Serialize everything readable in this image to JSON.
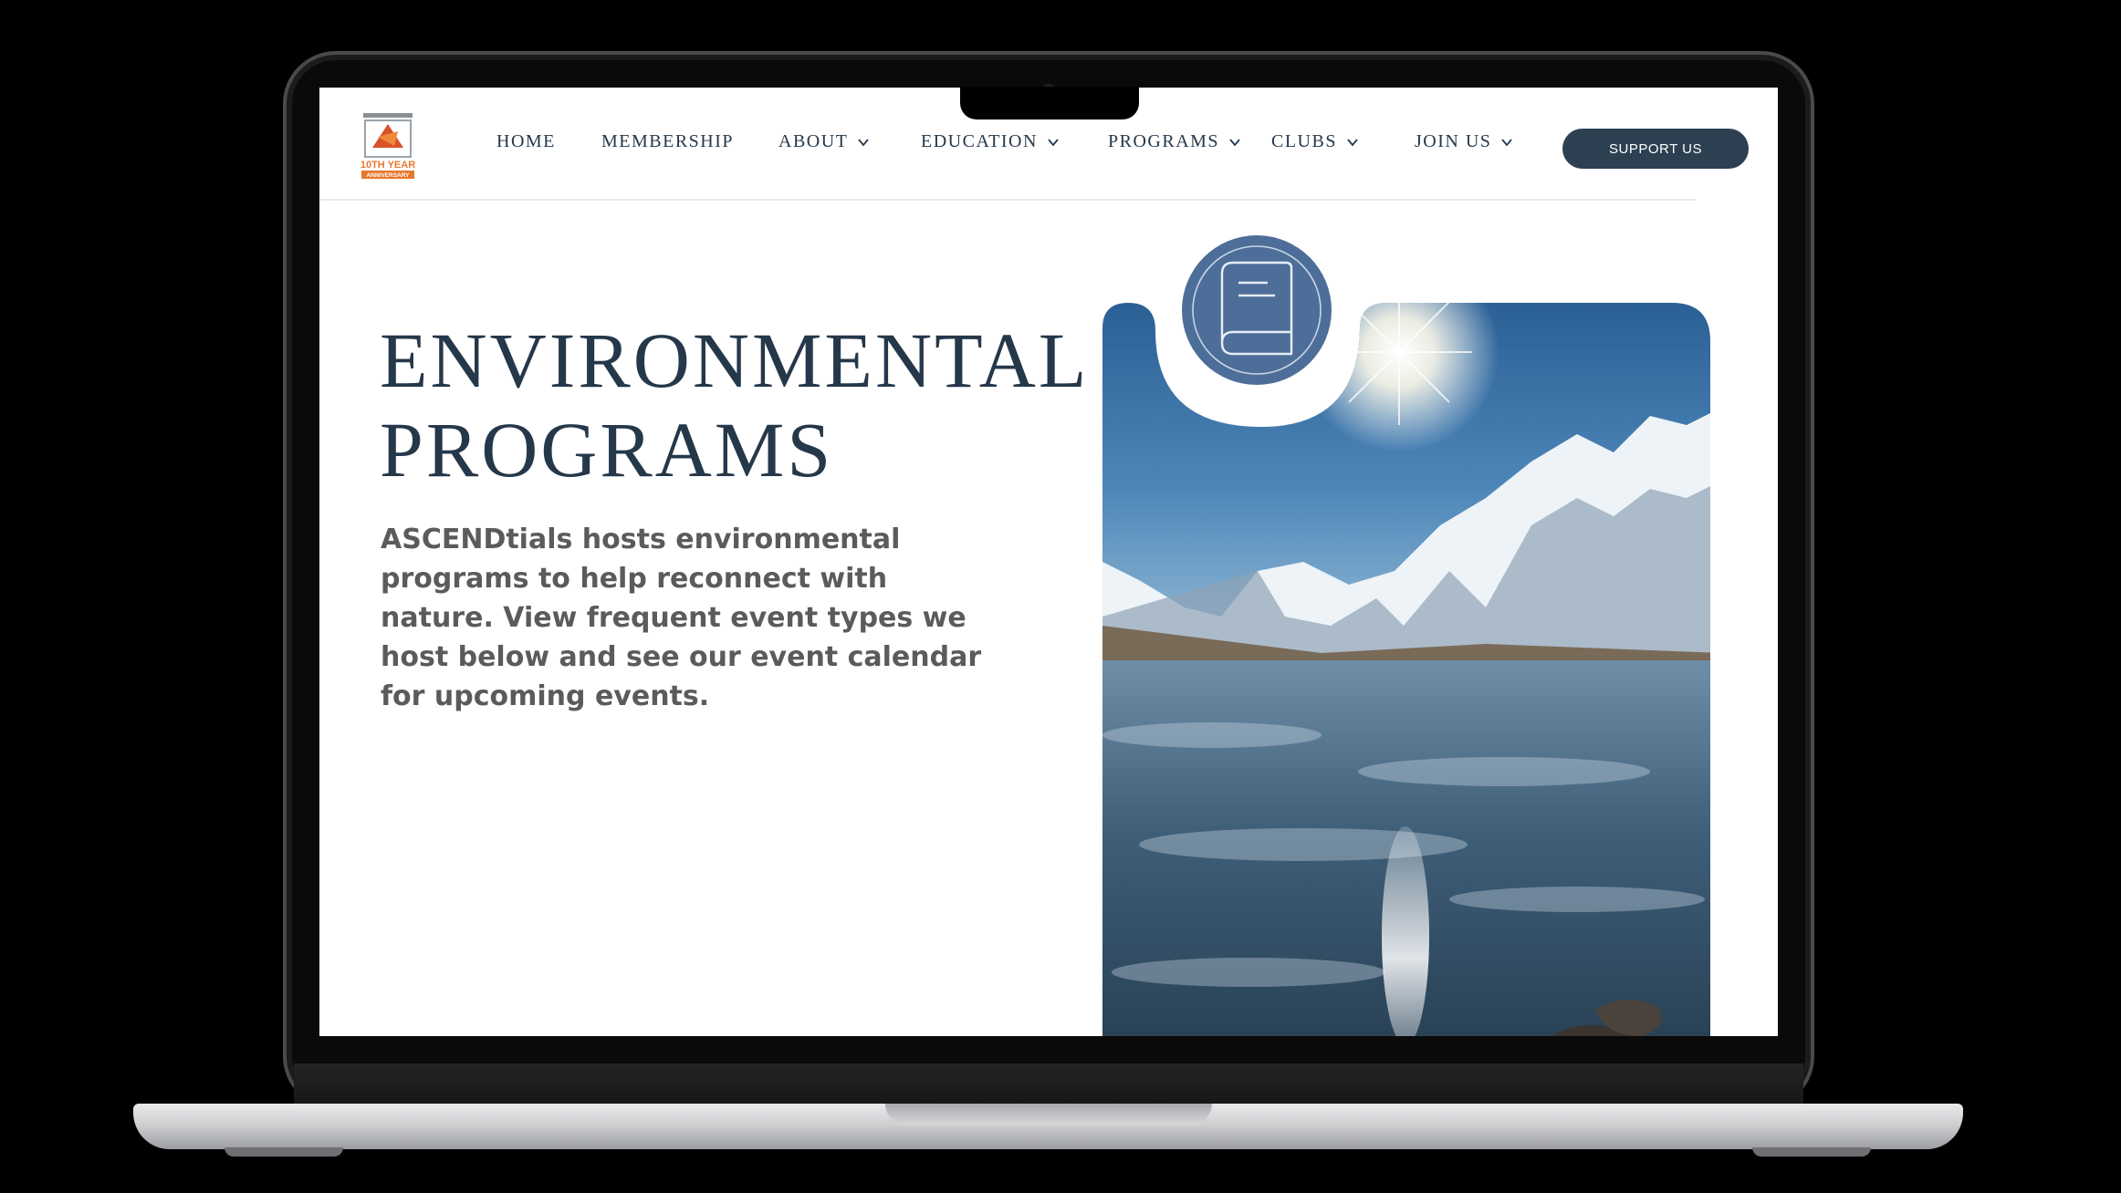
{
  "nav": {
    "items": [
      {
        "label": "HOME",
        "dropdown": false
      },
      {
        "label": "MEMBERSHIP",
        "dropdown": false
      },
      {
        "label": "ABOUT",
        "dropdown": true
      },
      {
        "label": "EDUCATION",
        "dropdown": true
      },
      {
        "label": "PROGRAMS",
        "dropdown": true
      },
      {
        "label": "CLUBS",
        "dropdown": true
      },
      {
        "label": "JOIN US",
        "dropdown": true
      }
    ],
    "cta_label": "SUPPORT US"
  },
  "logo": {
    "name": "10th-year-anniversary-logo",
    "text": "10TH YEAR ANNIVERSARY"
  },
  "hero": {
    "title_line1": "ENVIRONMENTAL",
    "title_line2": "PROGRAMS",
    "description": "ASCENDtials hosts environmental programs to help reconnect with nature. View frequent event types we host below and see our event calendar for upcoming events.",
    "image_subject": "frozen mountain lake with snowy peaks and sun",
    "badge_icon": "book-icon"
  },
  "colors": {
    "primary": "#25384a",
    "button": "#2d4052",
    "badge": "#4d6e98",
    "body_text": "#5b5b5b",
    "logo_accent": "#e8772e"
  }
}
